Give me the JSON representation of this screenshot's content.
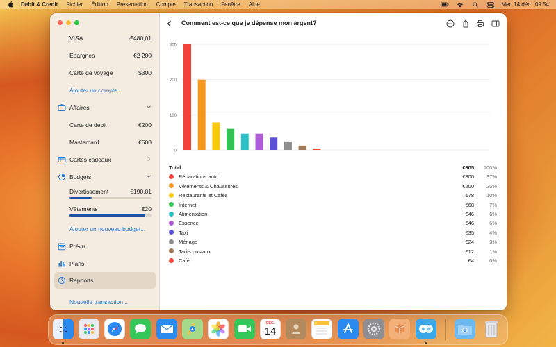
{
  "menubar": {
    "app_name": "Debit & Credit",
    "items": [
      "Fichier",
      "Édition",
      "Présentation",
      "Compte",
      "Transaction",
      "Fenêtre",
      "Aide"
    ],
    "datetime": "Mer. 14 déc.  09:54"
  },
  "sidebar": {
    "accounts": [
      {
        "label": "VISA",
        "amount": "-€480,01"
      },
      {
        "label": "Épargnes",
        "amount": "€2 200"
      },
      {
        "label": "Carte de voyage",
        "amount": "$300"
      }
    ],
    "add_account": "Ajouter un compte...",
    "business_group": "Affaires",
    "business_accounts": [
      {
        "label": "Carte de débit",
        "amount": "€200"
      },
      {
        "label": "Mastercard",
        "amount": "€500"
      }
    ],
    "gift_cards": "Cartes cadeaux",
    "budgets_group": "Budgets",
    "budgets": [
      {
        "label": "Divertissement",
        "amount": "€190,01",
        "progress": 0.27
      },
      {
        "label": "Vêtements",
        "amount": "€20",
        "progress": 0.92
      }
    ],
    "add_budget": "Ajouter un nouveau budget...",
    "scheduled": "Prévu",
    "plans": "Plans",
    "reports": "Rapports",
    "new_transaction": "Nouvelle transaction..."
  },
  "main": {
    "title": "Comment est-ce que je dépense mon argent?"
  },
  "chart_data": {
    "type": "bar",
    "title": "",
    "xlabel": "",
    "ylabel": "",
    "ylim": [
      0,
      300
    ],
    "yticks": [
      "0",
      "100",
      "200",
      "300"
    ],
    "categories": [
      "Réparations auto",
      "Vêtements & Chaussures",
      "Restaurants et Cafés",
      "Internet",
      "Alimentation",
      "Essence",
      "Taxi",
      "Ménage",
      "Tarifs postaux",
      "Café"
    ],
    "values": [
      300,
      200,
      78,
      60,
      46,
      46,
      35,
      24,
      12,
      4
    ],
    "colors": [
      "#f5423a",
      "#f49a1c",
      "#f9c90e",
      "#31c454",
      "#2bc3c9",
      "#b05bd9",
      "#5b50d6",
      "#8e8e8e",
      "#a17a57",
      "#f5423a"
    ]
  },
  "table": {
    "total": {
      "label": "Total",
      "value": "€805",
      "pct": "100%"
    },
    "rows": [
      {
        "label": "Réparations auto",
        "value": "€300",
        "pct": "37%"
      },
      {
        "label": "Vêtements & Chaussures",
        "value": "€200",
        "pct": "25%"
      },
      {
        "label": "Restaurants et Cafés",
        "value": "€78",
        "pct": "10%"
      },
      {
        "label": "Internet",
        "value": "€60",
        "pct": "7%"
      },
      {
        "label": "Alimentation",
        "value": "€46",
        "pct": "6%"
      },
      {
        "label": "Essence",
        "value": "€46",
        "pct": "6%"
      },
      {
        "label": "Taxi",
        "value": "€35",
        "pct": "4%"
      },
      {
        "label": "Ménage",
        "value": "€24",
        "pct": "3%"
      },
      {
        "label": "Tarifs postaux",
        "value": "€12",
        "pct": "1%"
      },
      {
        "label": "Café",
        "value": "€4",
        "pct": "0%"
      }
    ]
  },
  "dock": {
    "calendar_month": "DÉC.",
    "calendar_day": "14",
    "apps": [
      "finder",
      "launchpad",
      "safari",
      "messages",
      "mail",
      "maps",
      "photos",
      "facetime",
      "calendar",
      "contacts",
      "notes",
      "app-store",
      "system-settings",
      "box-app",
      "debit-credit",
      "downloads",
      "trash"
    ]
  }
}
